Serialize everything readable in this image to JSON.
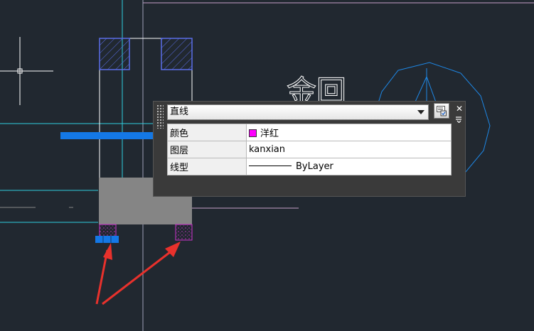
{
  "drawing": {
    "text_label": "金回"
  },
  "quick_properties": {
    "object_type": "直线",
    "select_button_icon": "quick-select-icon",
    "close_icon": "close-icon",
    "menu_icon": "options-menu-icon",
    "rows": [
      {
        "key": "颜色",
        "value": "洋红",
        "swatch_color": "#ff00ff"
      },
      {
        "key": "图层",
        "value": "kanxian"
      },
      {
        "key": "线型",
        "value": "ByLayer"
      }
    ]
  },
  "colors": {
    "background": "#212830",
    "cyan": "#2fd0e0",
    "blue_hatch": "#5a6ee8",
    "magenta": "#cc33cc",
    "annotation_red": "#e8312c",
    "blue_highlight": "#1478e6"
  }
}
